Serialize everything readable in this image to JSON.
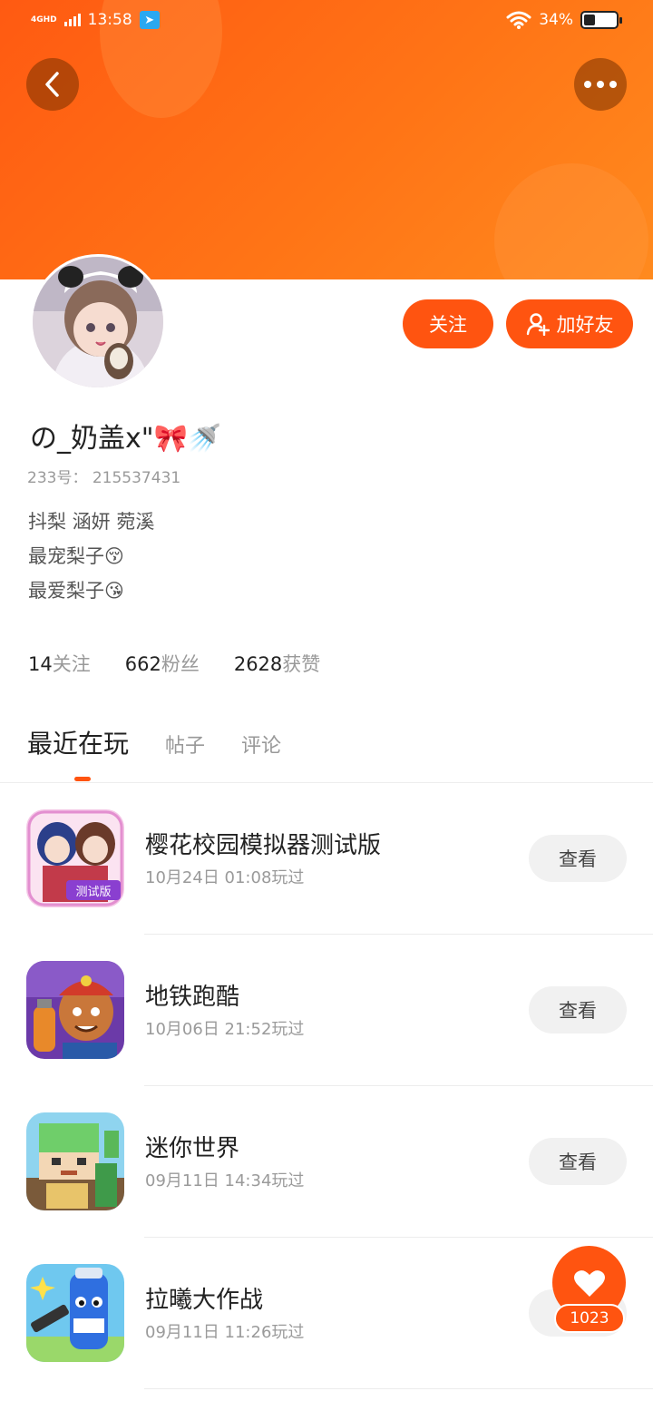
{
  "status_bar": {
    "network": "4GHD",
    "time": "13:58",
    "battery": "34%",
    "battery_level": 0.34
  },
  "header": {
    "back_icon": "chevron-left-icon",
    "more_icon": "more-dots-icon",
    "gradient_colors": [
      "#ff5a12",
      "#ff8a1e"
    ]
  },
  "actions": {
    "follow_label": "关注",
    "add_friend_label": "加好友",
    "accent": "#ff5410"
  },
  "profile": {
    "username": "の_奶盖x\"🎀🚿",
    "user_id": "233号： 215537431",
    "bio": [
      "抖梨 涵妍 菀溪",
      "最宠梨子😚",
      "最爱梨子😘"
    ]
  },
  "stats": [
    {
      "num": "14",
      "label": "关注"
    },
    {
      "num": "662",
      "label": "粉丝"
    },
    {
      "num": "2628",
      "label": "获赞"
    }
  ],
  "tabs": [
    "最近在玩",
    "帖子",
    "评论"
  ],
  "games": [
    {
      "title": "樱花校园模拟器测试版",
      "time": "10月24日 01:08玩过",
      "button": "查看",
      "icon_colors": [
        "#f4a6d8",
        "#6b3c9a"
      ]
    },
    {
      "title": "地铁跑酷",
      "time": "10月06日 21:52玩过",
      "button": "查看",
      "icon_colors": [
        "#7a3fb0",
        "#f08a2a"
      ]
    },
    {
      "title": "迷你世界",
      "time": "09月11日 14:34玩过",
      "button": "查看",
      "icon_colors": [
        "#5fc96a",
        "#e8c46a"
      ]
    },
    {
      "title": "拉曦大作战",
      "time": "09月11日 11:26玩过",
      "button": "查看",
      "icon_colors": [
        "#5aa8f0",
        "#2f5fd0"
      ]
    }
  ],
  "like": {
    "count": "1023",
    "icon": "heart-icon"
  }
}
